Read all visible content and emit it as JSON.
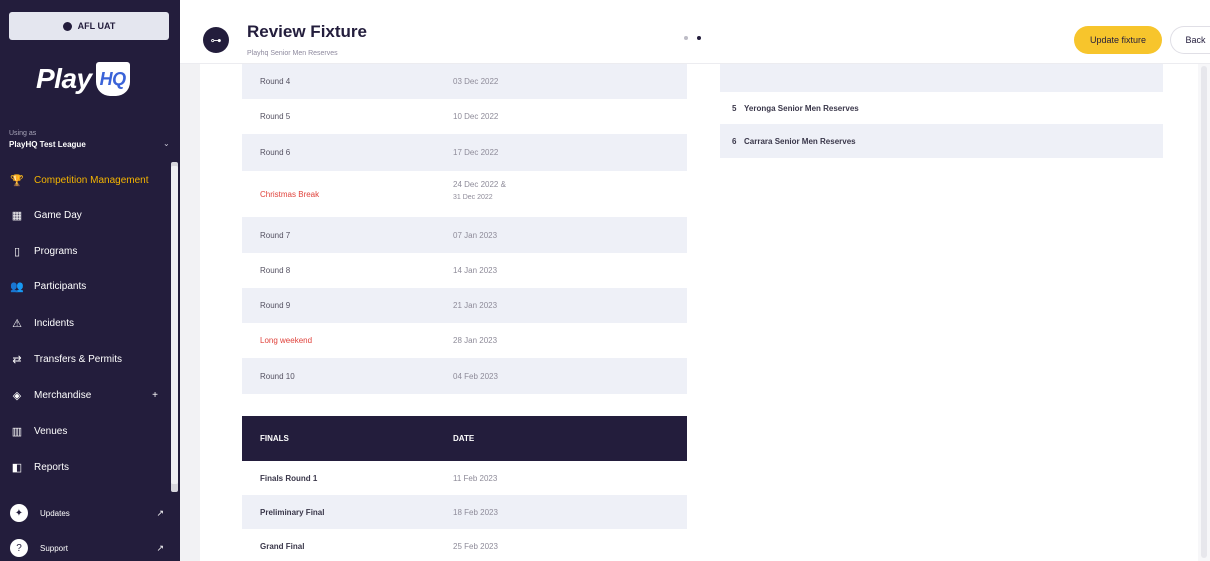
{
  "sidebar": {
    "env_badge": "AFL UAT",
    "logo_text": "Play",
    "logo_hq": "HQ",
    "org_label": "Using as",
    "org_name": "PlayHQ Test League",
    "nav": [
      {
        "label": "Competition Management",
        "icon": "trophy-icon",
        "glyph": "🏆",
        "active": true
      },
      {
        "label": "Game Day",
        "icon": "scoreboard-icon",
        "glyph": "▦"
      },
      {
        "label": "Programs",
        "icon": "book-icon",
        "glyph": "▯"
      },
      {
        "label": "Participants",
        "icon": "people-icon",
        "glyph": "👥"
      },
      {
        "label": "Incidents",
        "icon": "warning-icon",
        "glyph": "⚠"
      },
      {
        "label": "Transfers & Permits",
        "icon": "transfer-icon",
        "glyph": "⇄"
      },
      {
        "label": "Merchandise",
        "icon": "merchandise-icon",
        "glyph": "◈",
        "plus": "+"
      },
      {
        "label": "Venues",
        "icon": "venue-icon",
        "glyph": "▥"
      },
      {
        "label": "Reports",
        "icon": "reports-icon",
        "glyph": "◧"
      }
    ],
    "updates_label": "Updates",
    "support_label": "Support"
  },
  "header": {
    "title": "Review Fixture",
    "subtitle": "Playhq Senior Men Reserves",
    "update_button": "Update fixture",
    "back_button": "Back"
  },
  "rounds": [
    {
      "name": "Round 4",
      "date": "03 Dec 2022",
      "shade": true
    },
    {
      "name": "Round 5",
      "date": "10 Dec 2022",
      "shade": false
    },
    {
      "name": "Round 6",
      "date": "17 Dec 2022",
      "shade": true
    },
    {
      "name": "Christmas Break",
      "date": "24 Dec 2022 &",
      "date2": "31 Dec 2022",
      "shade": false,
      "red": true
    },
    {
      "name": "Round 7",
      "date": "07 Jan 2023",
      "shade": true
    },
    {
      "name": "Round 8",
      "date": "14 Jan 2023",
      "shade": false
    },
    {
      "name": "Round 9",
      "date": "21 Jan 2023",
      "shade": true
    },
    {
      "name": "Long weekend",
      "date": "28 Jan 2023",
      "shade": false,
      "red": true
    },
    {
      "name": "Round 10",
      "date": "04 Feb 2023",
      "shade": true
    }
  ],
  "finals": {
    "header_col1": "FINALS",
    "header_col2": "DATE",
    "rows": [
      {
        "name": "Finals Round 1",
        "date": "11 Feb 2023",
        "shade": false
      },
      {
        "name": "Preliminary Final",
        "date": "18 Feb 2023",
        "shade": true
      },
      {
        "name": "Grand Final",
        "date": "25 Feb 2023",
        "shade": false
      }
    ]
  },
  "teams": [
    {
      "num": "5",
      "name": "Yeronga Senior Men Reserves",
      "shade": false
    },
    {
      "num": "6",
      "name": "Carrara Senior Men Reserves",
      "shade": true
    }
  ]
}
